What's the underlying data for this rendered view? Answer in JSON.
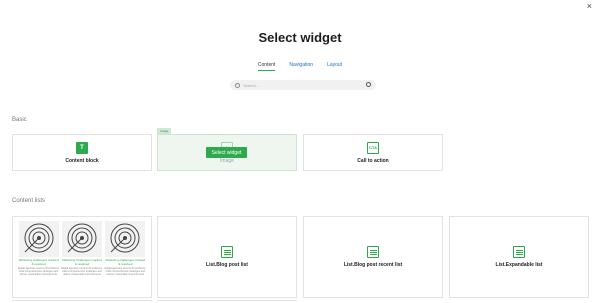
{
  "close_label": "×",
  "title": "Select widget",
  "tabs": [
    {
      "label": "Content",
      "active": true
    },
    {
      "label": "Navigation",
      "active": false
    },
    {
      "label": "Layout",
      "active": false
    }
  ],
  "search": {
    "placeholder": "Search..."
  },
  "sections": {
    "basic": "Basic",
    "content_lists": "Content lists"
  },
  "basic_widgets": {
    "content_block": {
      "icon": "T",
      "label": "Content block"
    },
    "image": {
      "icon": "IMG",
      "label": "Image",
      "badge": "Image",
      "select_button": "Select widget"
    },
    "call_to_action": {
      "icon": "CTA",
      "label": "Call to action"
    }
  },
  "list_widgets": {
    "blog_post_list": "List.Blog post list",
    "blog_post_recent_list": "List.Blog post recent list",
    "expandable_list": "List.Expandable list"
  },
  "blog_preview": {
    "items": [
      {
        "title": "Marketing challenges cracked & resolved",
        "desc": "Digital agencies need to ID problems, build comprehensive strategies and deliver measurable improvements"
      },
      {
        "title": "Marketing challenges cracked & resolved",
        "desc": "Digital agencies need to ID problems, build comprehensive strategies and deliver measurable improvements"
      },
      {
        "title": "Marketing challenges cracked & resolved",
        "desc": "Digital agencies need to ID problems, build comprehensive strategies and deliver measurable improvements"
      }
    ]
  },
  "colors": {
    "accent": "#2ea94d",
    "link": "#1a73c9"
  }
}
